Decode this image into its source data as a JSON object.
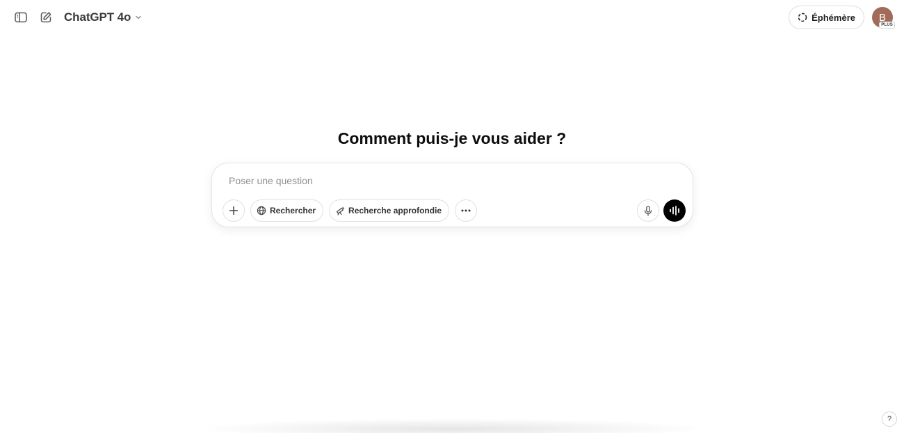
{
  "header": {
    "model_name": "ChatGPT 4o",
    "ephemeral_label": "Éphémère",
    "avatar_initial": "B",
    "plan_badge": "PLUS"
  },
  "main": {
    "heading": "Comment puis-je vous aider ?",
    "composer": {
      "placeholder": "Poser une question",
      "search_label": "Rechercher",
      "deep_research_label": "Recherche approfondie"
    }
  },
  "footer": {
    "help_label": "?"
  },
  "icons": {
    "sidebar_toggle": "sidebar-icon",
    "new_chat": "edit-icon",
    "model_dropdown": "chevron-down-icon",
    "ephemeral": "dashed-circle-icon",
    "attach": "plus-icon",
    "search": "globe-icon",
    "deep_research": "telescope-icon",
    "more": "ellipsis-icon",
    "dictate": "mic-icon",
    "voice_mode": "voice-wave-icon"
  },
  "colors": {
    "avatar_bg": "#a26a58",
    "voice_button_bg": "#000000"
  }
}
